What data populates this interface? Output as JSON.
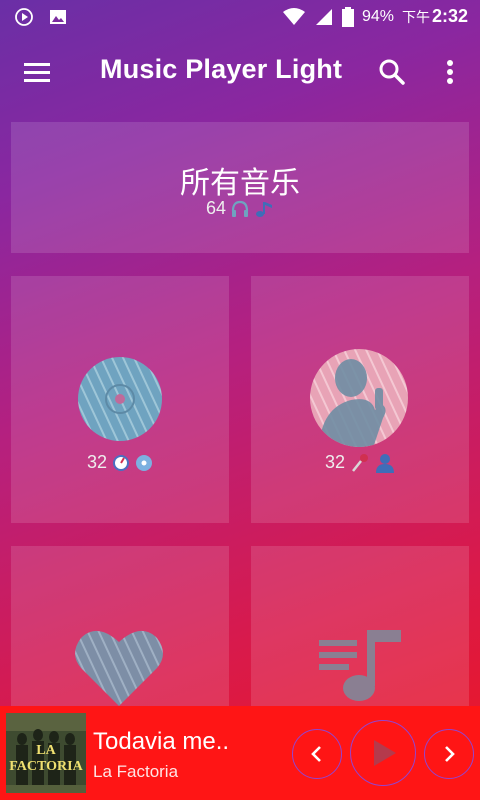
{
  "status_bar": {
    "battery": "94%",
    "time_period": "下午",
    "time": "2:32"
  },
  "app_bar": {
    "title": "Music Player Light",
    "icons": [
      "menu-icon",
      "search-icon",
      "more-vert-icon"
    ]
  },
  "library": {
    "all_music": {
      "title": "所有音乐",
      "count": "64"
    },
    "albums": {
      "count": "32"
    },
    "artists": {
      "count": "32"
    }
  },
  "now_playing": {
    "title": "Todavia me..",
    "artist": "La Factoria",
    "cover_text": "LA FACTORIA"
  },
  "colors": {
    "gradient_top": "#6a2fa6",
    "gradient_bottom": "#ee1620",
    "player_bar": "#ff1515",
    "art_tint": "#6fa3c0"
  }
}
